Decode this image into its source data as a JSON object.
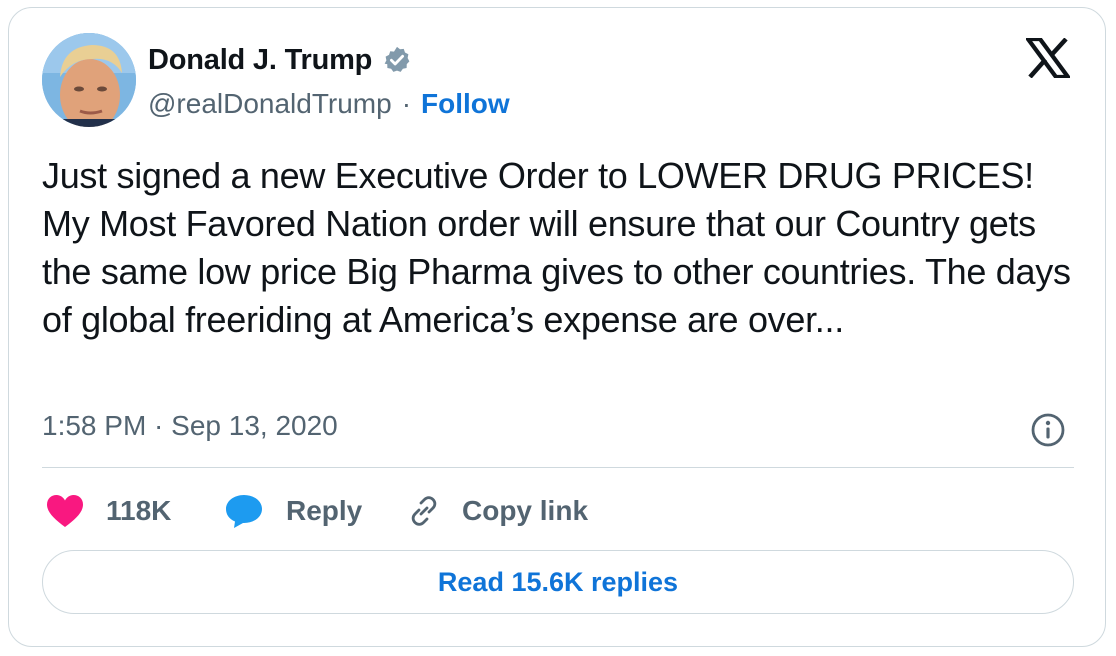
{
  "author": {
    "name": "Donald J. Trump",
    "handle": "@realDonaldTrump",
    "separator": "·",
    "follow_label": "Follow",
    "verified": true
  },
  "tweet": {
    "text": "Just signed a new Executive Order to LOWER DRUG PRICES! My Most Favored Nation order will ensure that our Country gets the same low price Big Pharma gives to other countries. The days of global freeriding at America’s expense are over...",
    "timestamp": "1:58 PM · Sep 13, 2020"
  },
  "actions": {
    "likes_count": "118K",
    "reply_label": "Reply",
    "copy_link_label": "Copy link"
  },
  "footer": {
    "read_replies_label": "Read 15.6K replies"
  },
  "icons": {
    "brand": "x-logo-icon",
    "verified": "verified-badge-icon",
    "info": "info-icon",
    "like": "heart-icon",
    "reply": "speech-bubble-icon",
    "copy_link": "link-icon"
  },
  "colors": {
    "text_primary": "#0f1419",
    "text_secondary": "#536471",
    "link_blue": "#0f74d8",
    "heart_pink": "#f91880",
    "reply_blue": "#1d9bf0",
    "border": "#cfd9de",
    "verified_gray": "#829aab"
  }
}
